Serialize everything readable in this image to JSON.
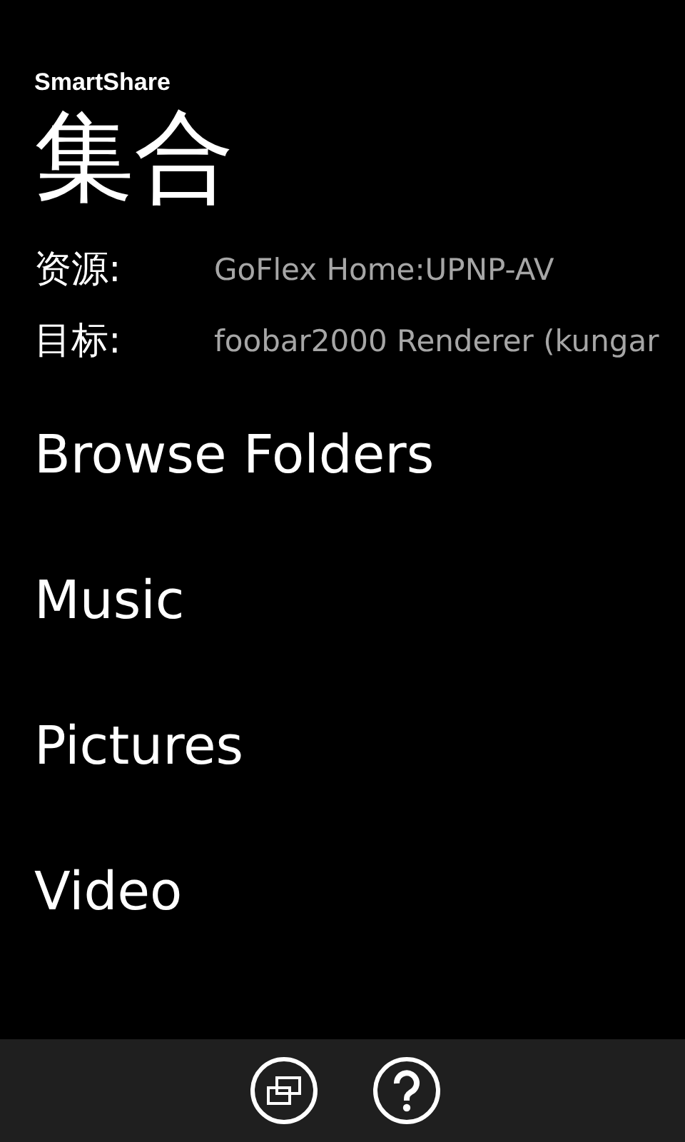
{
  "app_title": "SmartShare",
  "page_title": "集合",
  "info": [
    {
      "label": "资源:",
      "value": "GoFlex Home:UPNP-AV"
    },
    {
      "label": "目标:",
      "value": "foobar2000 Renderer (kungar"
    }
  ],
  "menu": [
    "Browse Folders",
    "Music",
    "Pictures",
    "Video"
  ],
  "app_bar": [
    {
      "kind": "switch"
    },
    {
      "kind": "help"
    }
  ]
}
